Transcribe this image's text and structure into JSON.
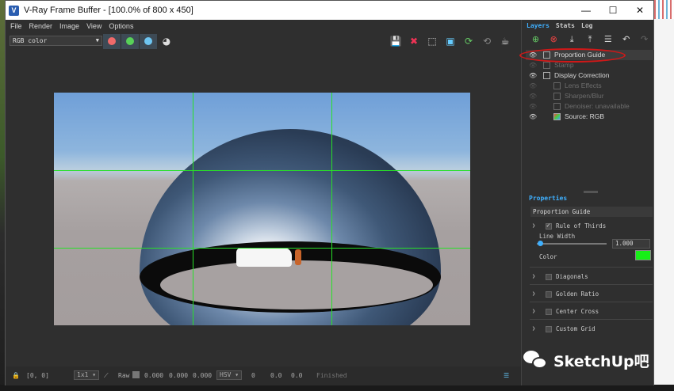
{
  "window": {
    "title": "V-Ray Frame Buffer - [100.0% of 800 x 450]",
    "app_icon": "vray-icon",
    "minimize": "—",
    "maximize": "☐",
    "close": "✕"
  },
  "menu": [
    "File",
    "Render",
    "Image",
    "View",
    "Options"
  ],
  "toolbar": {
    "channel": "RGB color",
    "channel_buttons": [
      {
        "icon": "red-channel-icon",
        "color": "#f06a6a"
      },
      {
        "icon": "green-channel-icon",
        "color": "#58d158"
      },
      {
        "icon": "blue-channel-icon",
        "color": "#6ec6f2"
      }
    ],
    "mono_icon": "mono-channel-icon",
    "right_icons": [
      "save-image-icon",
      "clear-image-icon",
      "region-render-icon",
      "track-mouse-icon",
      "refresh-render-icon",
      "stop-render-icon",
      "teapot-render-icon"
    ]
  },
  "viewport": {
    "guide_color": "#28e028",
    "guide": "Rule of Thirds"
  },
  "statusbar": {
    "coords": "[0, 0]",
    "zoom": "1x1",
    "mode": "Raw",
    "rgb_values": [
      "0.000",
      "0.000",
      "0.000"
    ],
    "color_space": "HSV",
    "hsv_values": [
      "0",
      "0.0",
      "0.0"
    ],
    "status": "Finished"
  },
  "panel": {
    "tabs": [
      "Layers",
      "Stats",
      "Log"
    ],
    "active_tab": "Layers",
    "layer_tools": [
      "add-layer-icon",
      "delete-layer-icon",
      "save-layers-icon",
      "load-layers-icon",
      "list-icon",
      "undo-icon",
      "redo-icon"
    ],
    "layers": [
      {
        "label": "Proportion Guide",
        "visible": true,
        "selected": true,
        "dim": false
      },
      {
        "label": "Stamp",
        "visible": false,
        "selected": false,
        "dim": true
      },
      {
        "label": "Display Correction",
        "visible": true,
        "selected": false,
        "dim": false
      },
      {
        "label": "Lens Effects",
        "visible": false,
        "selected": false,
        "dim": true
      },
      {
        "label": "Sharpen/Blur",
        "visible": false,
        "selected": false,
        "dim": true
      },
      {
        "label": "Denoiser: unavailable",
        "visible": false,
        "selected": false,
        "dim": true
      },
      {
        "label": "Source: RGB",
        "visible": true,
        "selected": false,
        "dim": false
      }
    ],
    "properties": {
      "heading": "Properties",
      "layer_name": "Proportion Guide",
      "rule_of_thirds": "Rule of Thirds",
      "line_width_label": "Line Width",
      "line_width_value": "1.000",
      "color_label": "Color",
      "color_value": "#16f016",
      "sections": [
        "Diagonals",
        "Golden Ratio",
        "Center Cross",
        "Custom Grid"
      ]
    }
  },
  "watermark": {
    "text": "SketchUp吧",
    "icon": "wechat-icon"
  }
}
